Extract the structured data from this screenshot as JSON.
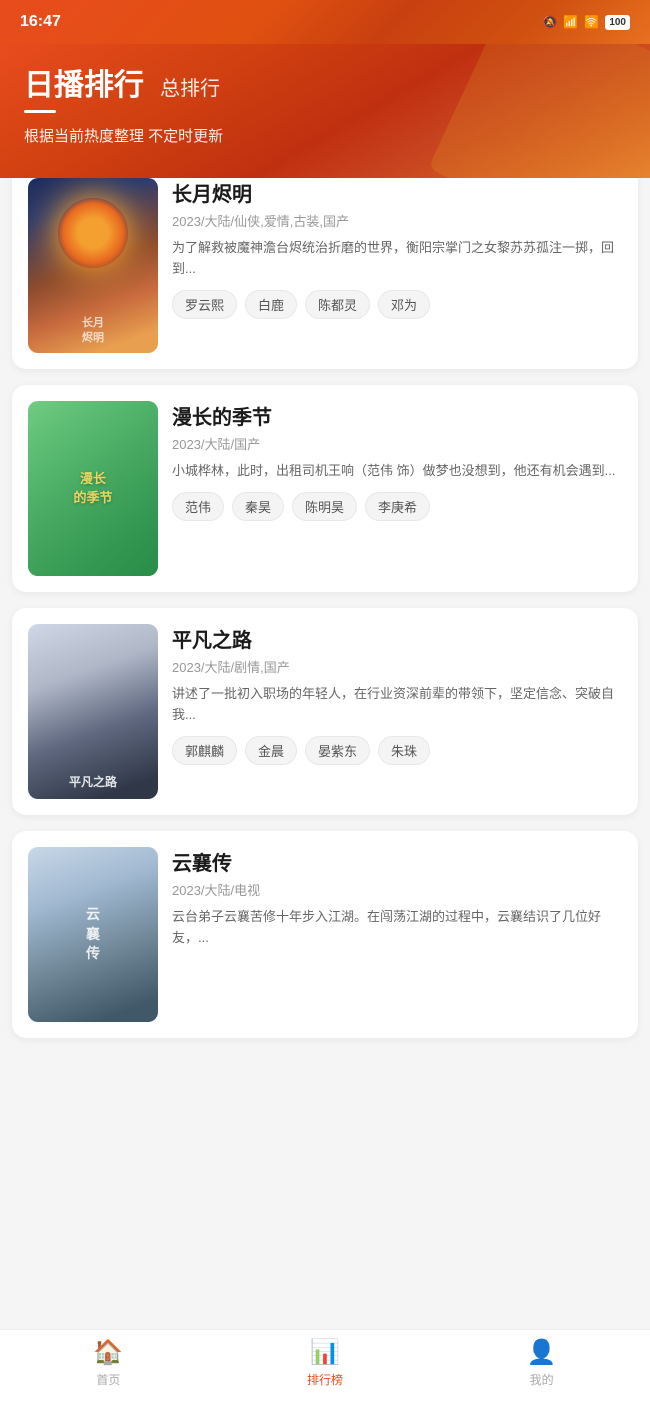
{
  "statusBar": {
    "time": "16:47",
    "battery": "100"
  },
  "header": {
    "mainTitle": "日播排行",
    "subTitle": "总排行",
    "underline": true,
    "desc": "根据当前热度整理 不定时更新"
  },
  "shows": [
    {
      "id": 1,
      "title": "长月烬明",
      "meta": "2023/大陆/仙侠,爱情,古装,国产",
      "desc": "为了解救被魔神澹台烬统治折磨的世界，衡阳宗掌门之女黎苏苏孤注一掷，回到...",
      "tags": [
        "罗云熙",
        "白鹿",
        "陈都灵",
        "邓为"
      ],
      "posterLabel": "长月\n烬明"
    },
    {
      "id": 2,
      "title": "漫长的季节",
      "meta": "2023/大陆/国产",
      "desc": "小城桦林，此时，出租司机王响（范伟 饰）做梦也没想到，他还有机会遇到...",
      "tags": [
        "范伟",
        "秦昊",
        "陈明昊",
        "李庚希"
      ],
      "posterLabel": "漫长\n的季节"
    },
    {
      "id": 3,
      "title": "平凡之路",
      "meta": "2023/大陆/剧情,国产",
      "desc": "讲述了一批初入职场的年轻人，在行业资深前辈的带领下，坚定信念、突破自我...",
      "tags": [
        "郭麒麟",
        "金晨",
        "晏紫东",
        "朱珠"
      ],
      "posterLabel": "平凡之路"
    },
    {
      "id": 4,
      "title": "云襄传",
      "meta": "2023/大陆/电视",
      "desc": "云台弟子云襄苦修十年步入江湖。在闯荡江湖的过程中，云襄结识了几位好友，...",
      "tags": [],
      "posterLabel": "云\n襄\n传"
    }
  ],
  "bottomNav": {
    "items": [
      {
        "id": "home",
        "label": "首页",
        "active": false
      },
      {
        "id": "ranking",
        "label": "排行榜",
        "active": true
      },
      {
        "id": "mine",
        "label": "我的",
        "active": false
      }
    ]
  }
}
